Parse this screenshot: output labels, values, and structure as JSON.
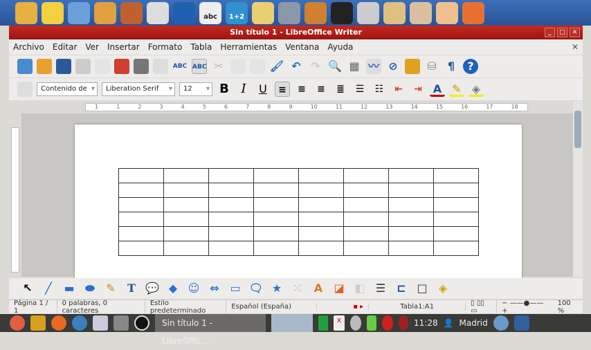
{
  "dock": {
    "colors": [
      "#e8b040",
      "#f2d040",
      "#6aa0d8",
      "#e0a040",
      "#c06030",
      "#dddddd",
      "#2060b0",
      "#222222",
      "#3090d0",
      "#e8d070",
      "#8a98a8",
      "#d08030",
      "#222222",
      "#cccccc",
      "#e0c080",
      "#d8c0a0",
      "#f0c090",
      "#e87030"
    ],
    "label_calc": "1+2",
    "label_abc": "abc"
  },
  "window": {
    "title": "Sin título 1 - LibreOffice Writer",
    "accent": "#b01e18"
  },
  "menu": [
    "Archivo",
    "Editar",
    "Ver",
    "Insertar",
    "Formato",
    "Tabla",
    "Herramientas",
    "Ventana",
    "Ayuda"
  ],
  "toolbar": {
    "style": "Contenido de",
    "font": "Liberation Serif",
    "size": "12",
    "bold": "B",
    "italic": "I",
    "underline": "U",
    "spell1": "ABC",
    "spell2": "ABC",
    "pilcrow": "¶",
    "help": "?"
  },
  "ruler": [
    "1",
    "1",
    "2",
    "3",
    "4",
    "5",
    "6",
    "7",
    "8",
    "9",
    "10",
    "11",
    "12",
    "13",
    "14",
    "15",
    "16",
    "17",
    "18"
  ],
  "table": {
    "rows": 6,
    "cols": 8
  },
  "status": {
    "page": "Página 1 / 1",
    "words": "0 palabras, 0 caracteres",
    "style": "Estilo predeterminado",
    "lang": "Español (España)",
    "cell": "Tabla1:A1",
    "zoom": "100 %"
  },
  "taskbar": {
    "window": "Sin título 1 - LibreOffic...",
    "time": "11:28",
    "city": "Madrid"
  }
}
